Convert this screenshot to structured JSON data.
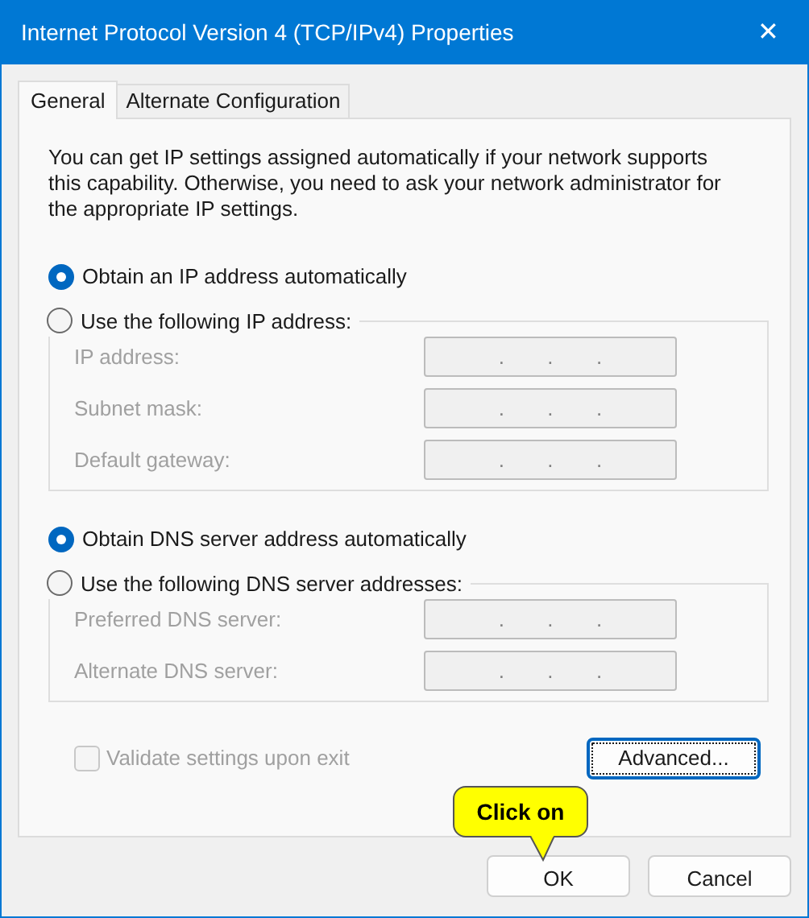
{
  "window": {
    "title": "Internet Protocol Version 4 (TCP/IPv4) Properties",
    "close": "✕"
  },
  "tabs": [
    {
      "label": "General",
      "selected": true
    },
    {
      "label": "Alternate Configuration",
      "selected": false
    }
  ],
  "intro": "You can get IP settings assigned automatically if your network supports this capability. Otherwise, you need to ask your network administrator for the appropriate IP settings.",
  "ip_section": {
    "auto_option": {
      "label": "Obtain an IP address automatically",
      "selected": true
    },
    "manual_option": {
      "label": "Use the following IP address:",
      "selected": false
    },
    "fields": [
      {
        "label": "IP address:",
        "dots": [
          ".",
          ".",
          "."
        ],
        "disabled": true
      },
      {
        "label": "Subnet mask:",
        "dots": [
          ".",
          ".",
          "."
        ],
        "disabled": true
      },
      {
        "label": "Default gateway:",
        "dots": [
          ".",
          ".",
          "."
        ],
        "disabled": true
      }
    ]
  },
  "dns_section": {
    "auto_option": {
      "label": "Obtain DNS server address automatically",
      "selected": true
    },
    "manual_option": {
      "label": "Use the following DNS server addresses:",
      "selected": false
    },
    "fields": [
      {
        "label": "Preferred DNS server:",
        "dots": [
          ".",
          ".",
          "."
        ],
        "disabled": true
      },
      {
        "label": "Alternate DNS server:",
        "dots": [
          ".",
          ".",
          "."
        ],
        "disabled": true
      }
    ]
  },
  "validate": {
    "label": "Validate settings upon exit",
    "checked": false,
    "disabled": true
  },
  "advanced_button": "Advanced...",
  "buttons": [
    "OK",
    "Cancel"
  ],
  "callout": {
    "text": "Click on"
  }
}
